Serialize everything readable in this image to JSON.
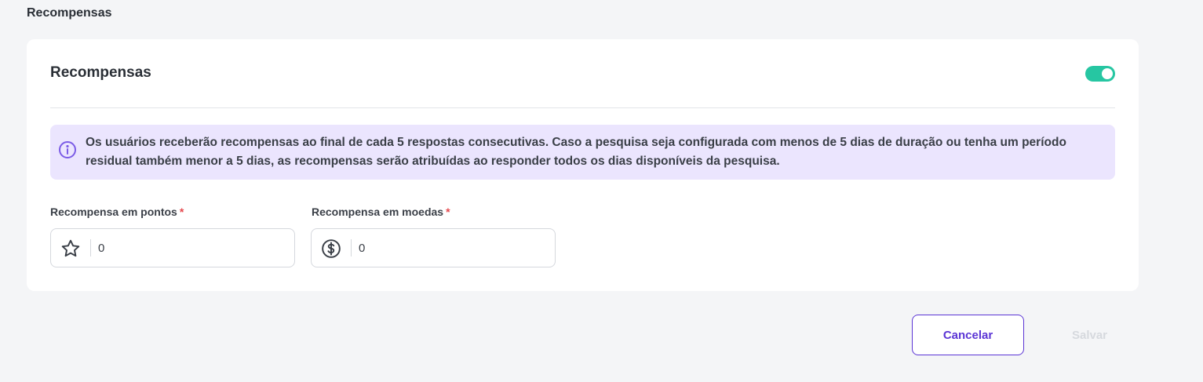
{
  "page": {
    "heading": "Recompensas"
  },
  "card": {
    "title": "Recompensas",
    "toggle": {
      "on": true,
      "color": "#26c6a2"
    },
    "info": {
      "icon": "info-icon",
      "text": "Os usuários receberão recompensas ao final de cada 5 respostas consecutivas. Caso a pesquisa seja configurada com menos de 5 dias de duração ou tenha um período residual também menor a 5 dias, as recompensas serão atribuídas ao responder todos os dias disponíveis da pesquisa."
    },
    "fields": [
      {
        "label": "Recompensa em pontos",
        "required": "*",
        "icon": "star-icon",
        "value": "0"
      },
      {
        "label": "Recompensa em moedas",
        "required": "*",
        "icon": "dollar-coin-icon",
        "value": "0"
      }
    ]
  },
  "actions": {
    "cancel_label": "Cancelar",
    "save_label": "Salvar"
  },
  "colors": {
    "accent": "#5b35d5",
    "toggle": "#26c6a2",
    "info_bg": "#ebe5fe",
    "required": "#e5484d"
  }
}
